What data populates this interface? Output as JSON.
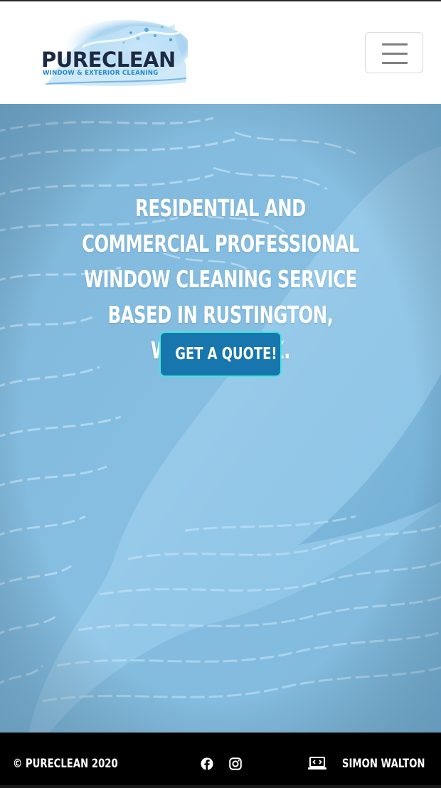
{
  "navbar": {
    "logo_word": "PURECLEAN",
    "logo_tagline": "WINDOW & EXTERIOR CLEANING",
    "menu_icon": "hamburger-menu-icon"
  },
  "hero": {
    "headline": "Residential and Commercial Professional Window Cleaning service based in Rustington, West Sussex.",
    "cta_label": "Get a Quote!",
    "background": "soapy window glass with squeegee streak"
  },
  "footer": {
    "copyright": "© PureClean 2020",
    "social_icons": [
      "facebook-icon",
      "instagram-icon"
    ],
    "credit_icon": "laptop-code-icon",
    "credit_name": "Simon Walton"
  },
  "colors": {
    "hero_blue": "#7ab6da",
    "button_bg": "#1876ae",
    "button_border": "#41e6e0",
    "footer_bg": "#000000",
    "logo_navy": "#1d2a44",
    "logo_blue": "#2487c8"
  }
}
